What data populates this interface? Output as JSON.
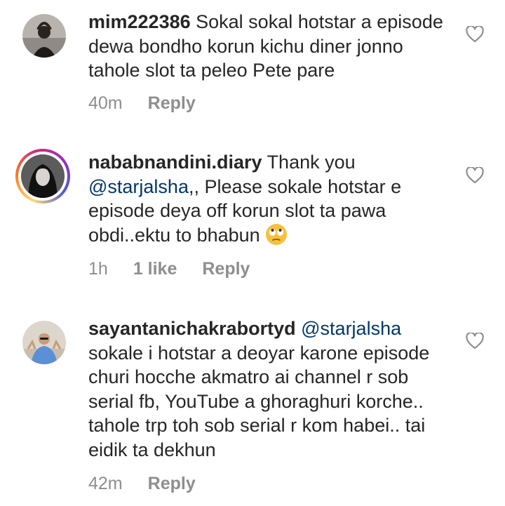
{
  "comments": [
    {
      "username": "mim222386",
      "mention": "",
      "text": "Sokal sokal hotstar a episode dewa bondho korun kichu diner jonno tahole slot ta peleo Pete pare",
      "time": "40m",
      "likes": "",
      "reply_label": "Reply",
      "avatar_icon": "avatar-user-photo",
      "has_story_ring": false
    },
    {
      "username": "nababnandini.diary",
      "mention": "@starjalsha",
      "text_before": "Thank you",
      "text_after": ",, Please sokale hotstar e episode deya off korun slot ta pawa obdi..ektu to bhabun",
      "emoji": "face-with-rolling-eyes",
      "time": "1h",
      "likes": "1 like",
      "reply_label": "Reply",
      "avatar_icon": "avatar-user-photo",
      "has_story_ring": true
    },
    {
      "username": "sayantanichakrabortyd",
      "mention": "@starjalsha",
      "text": "sokale i hotstar a deoyar karone episode churi hocche akmatro ai channel r sob serial fb, YouTube a ghoraghuri korche.. tahole trp toh sob serial r kom habei.. tai eidik ta dekhun",
      "time": "42m",
      "likes": "",
      "reply_label": "Reply",
      "avatar_icon": "avatar-user-photo",
      "has_story_ring": false
    }
  ],
  "icons": {
    "like": "heart-outline-icon"
  },
  "colors": {
    "text": "#262626",
    "muted": "#8e8e8e",
    "mention": "#00376b"
  }
}
